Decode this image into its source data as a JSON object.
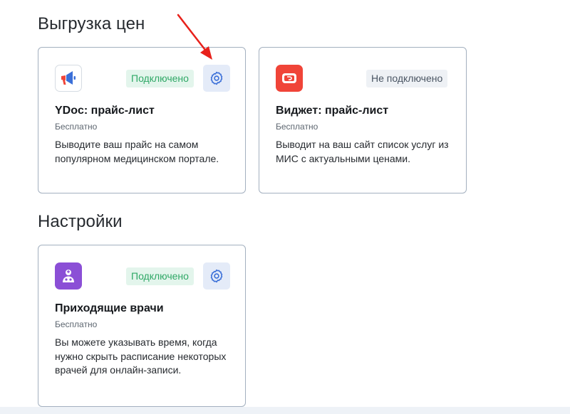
{
  "sections": {
    "export": {
      "title": "Выгрузка цен",
      "cards": [
        {
          "title": "YDoc: прайс-лист",
          "price": "Бесплатно",
          "description": "Выводите ваш прайс на самом популярном медицинском портале.",
          "status": "Подключено",
          "icon": "megaphone-icon"
        },
        {
          "title": "Виджет: прайс-лист",
          "price": "Бесплатно",
          "description": "Выводит на ваш сайт список услуг из МИС с актуальными ценами.",
          "status": "Не подключено",
          "icon": "widget-icon"
        }
      ]
    },
    "settings": {
      "title": "Настройки",
      "cards": [
        {
          "title": "Приходящие врачи",
          "price": "Бесплатно",
          "description": "Вы можете указывать время, когда нужно скрыть расписание некоторых врачей для онлайн-записи.",
          "status": "Подключено",
          "icon": "doctor-icon"
        }
      ]
    }
  },
  "colors": {
    "accent": "#3a6fd8",
    "connected": "#2fa866",
    "widget_red": "#f04438",
    "doctor_purple": "#8b4fd6",
    "annotation_arrow": "#e8211b"
  }
}
